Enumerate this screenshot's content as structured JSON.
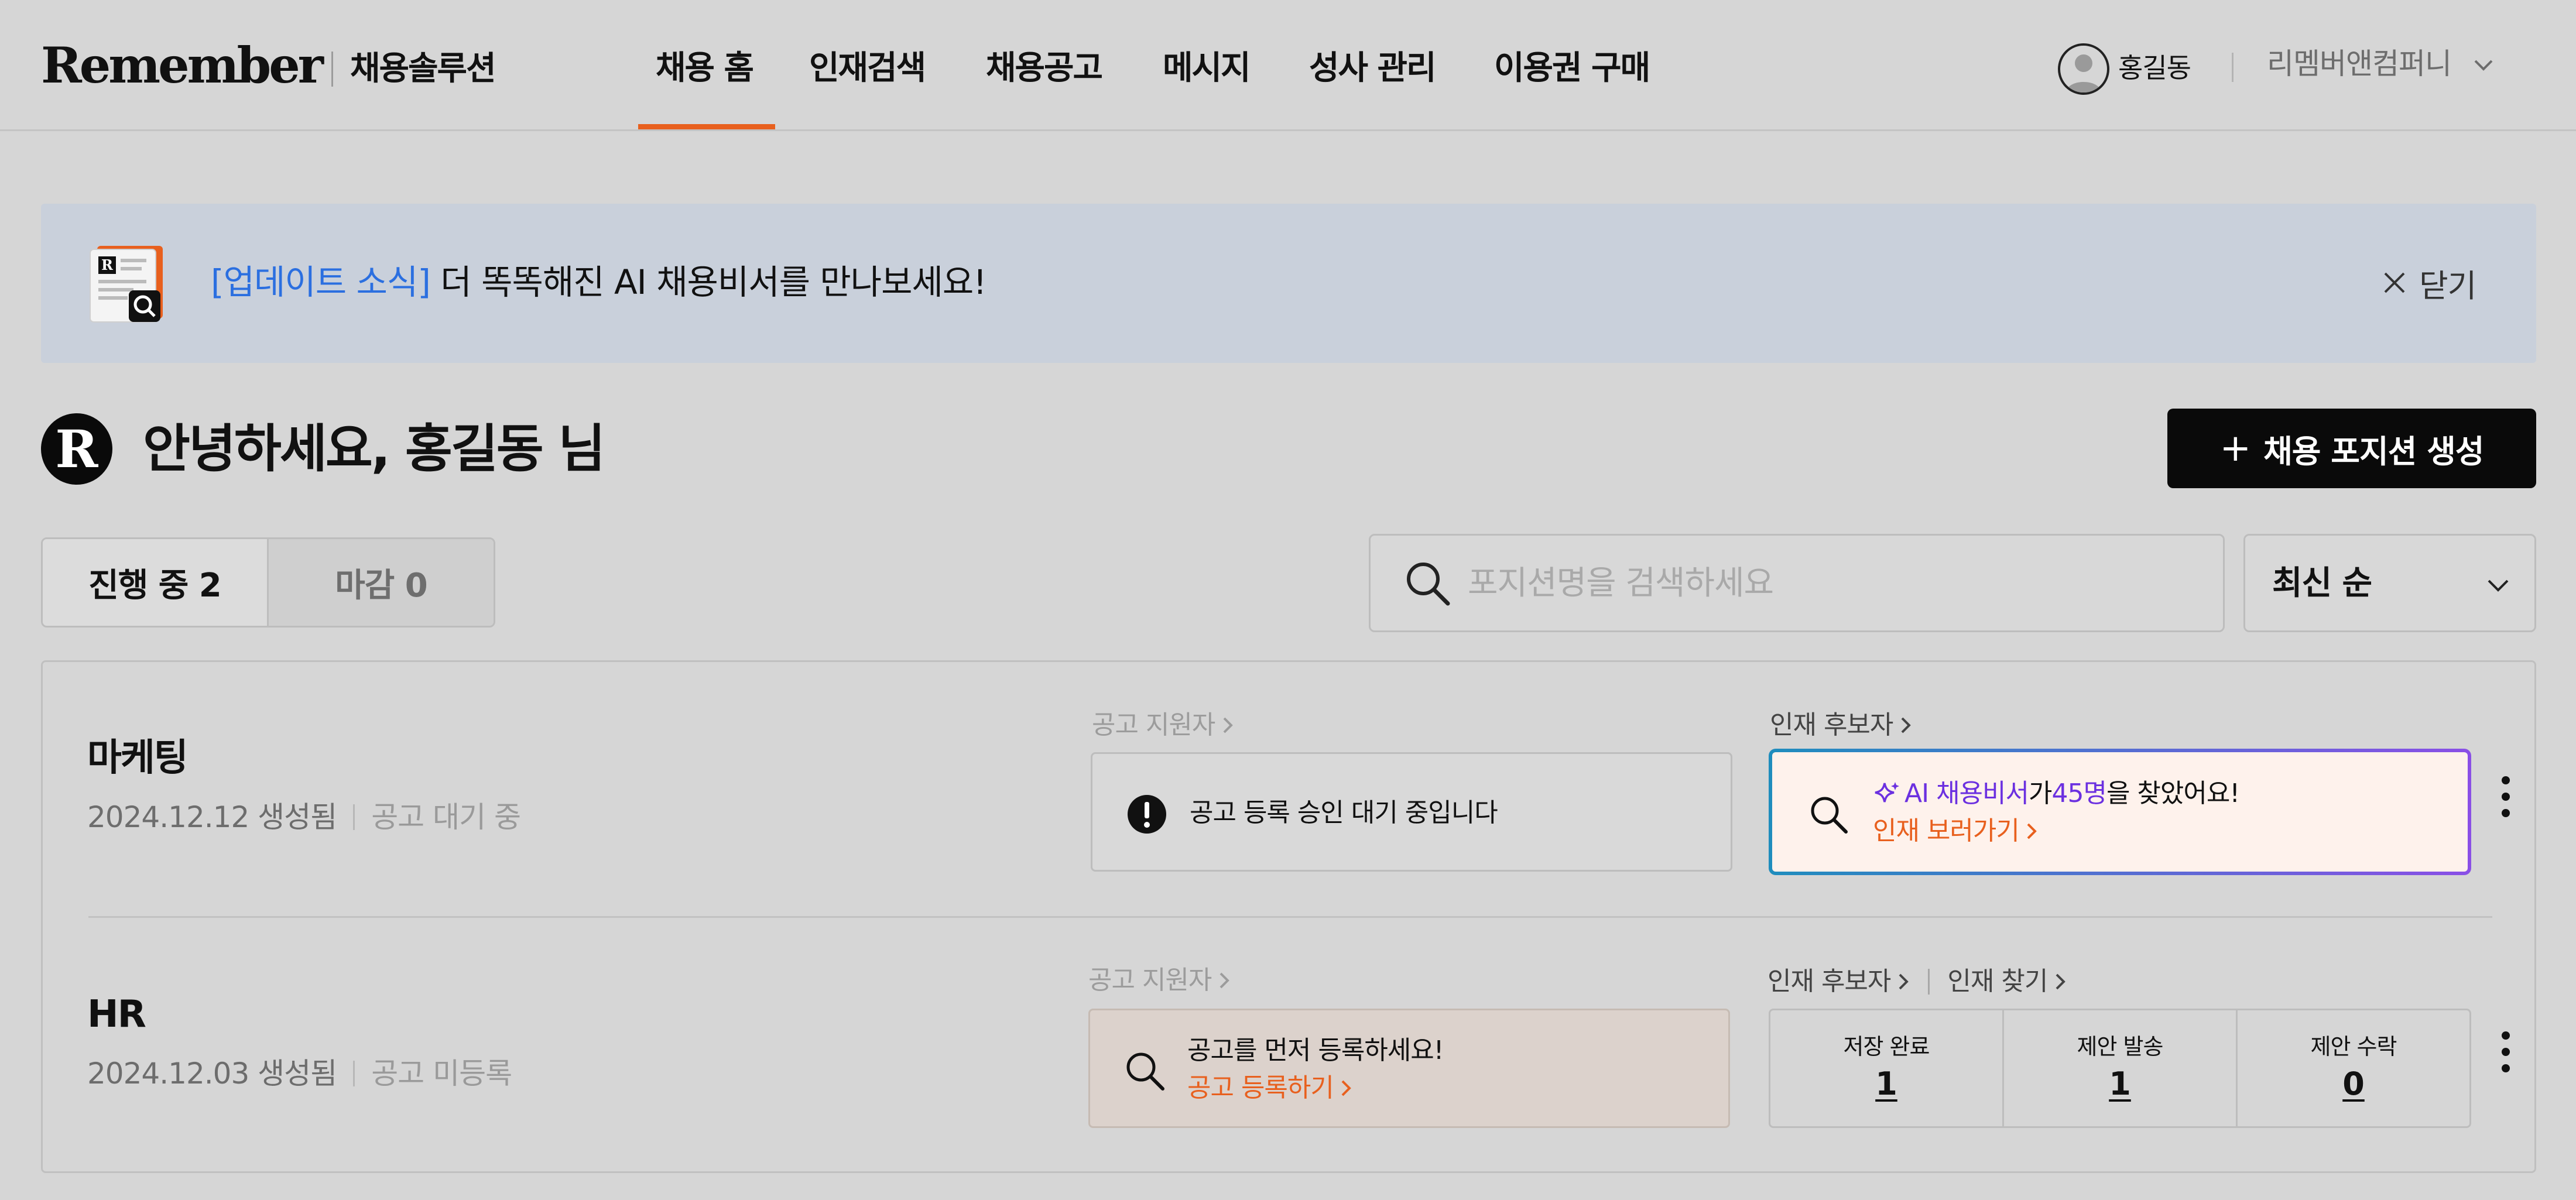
{
  "header": {
    "logo_text": "Remember",
    "logo_subtitle": "채용솔루션",
    "nav": [
      {
        "label": "채용 홈",
        "active": true
      },
      {
        "label": "인재검색"
      },
      {
        "label": "채용공고"
      },
      {
        "label": "메시지"
      },
      {
        "label": "성사 관리"
      },
      {
        "label": "이용권 구매"
      }
    ],
    "user_name": "홍길동",
    "company_name": "리멤버앤컴퍼니"
  },
  "banner": {
    "tag": "[업데이트 소식]",
    "message": "더 똑똑해진 AI 채용비서를 만나보세요!",
    "close_label": "닫기"
  },
  "greeting": {
    "logo_letter": "R",
    "text": "안녕하세요, 홍길동 님"
  },
  "create_button": {
    "plus": "+",
    "label": "채용 포지션 생성"
  },
  "tabs": {
    "ongoing": "진행 중 2",
    "closed": "마감 0"
  },
  "search": {
    "placeholder": "포지션명을 검색하세요"
  },
  "sort": {
    "selected": "최신 순"
  },
  "positions": [
    {
      "title": "마케팅",
      "created": "2024.12.12 생성됨",
      "status": "공고 대기 중",
      "applicants_label": "공고 지원자",
      "candidates_label": "인재 후보자",
      "pending_message": "공고 등록 승인 대기 중입니다",
      "ai_name": "AI 채용비서",
      "ai_particle": "가 ",
      "ai_count": "45명",
      "ai_suffix": "을 찾았어요!",
      "ai_link": "인재 보러가기"
    },
    {
      "title": "HR",
      "created": "2024.12.03 생성됨",
      "status": "공고 미등록",
      "applicants_label": "공고 지원자",
      "candidates_label": "인재 후보자",
      "find_label": "인재 찾기",
      "register_message": "공고를 먼저 등록하세요!",
      "register_link": "공고 등록하기",
      "stats": [
        {
          "label": "저장 완료",
          "value": "1"
        },
        {
          "label": "제안 발송",
          "value": "1"
        },
        {
          "label": "제안 수락",
          "value": "0"
        }
      ]
    }
  ],
  "colors": {
    "accent": "#e8601e",
    "link_blue": "#2b6fe0",
    "ai_purple": "#6b30e0",
    "page_bg": "#d6d6d6",
    "banner_bg": "#c9d0db"
  }
}
